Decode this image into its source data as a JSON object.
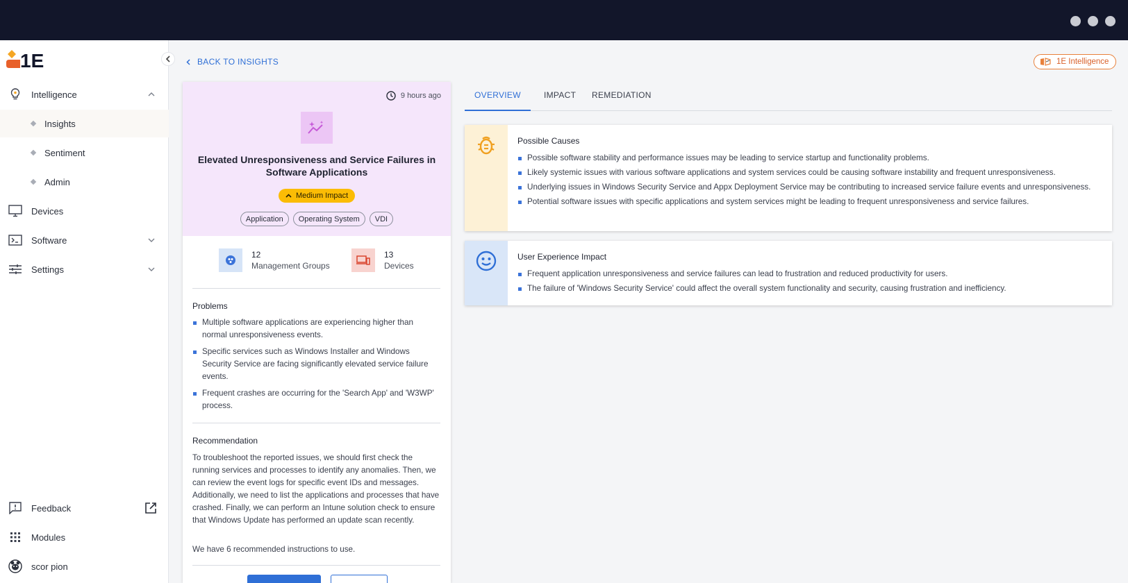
{
  "sidebar": {
    "brand_text": "1E",
    "items": [
      {
        "label": "Intelligence"
      },
      {
        "label": "Insights"
      },
      {
        "label": "Sentiment"
      },
      {
        "label": "Admin"
      },
      {
        "label": "Devices"
      },
      {
        "label": "Software"
      },
      {
        "label": "Settings"
      }
    ],
    "bottom": [
      {
        "label": "Feedback"
      },
      {
        "label": "Modules"
      },
      {
        "label": "scor pion"
      }
    ]
  },
  "header": {
    "back_label": "BACK TO INSIGHTS",
    "badge_label": "1E Intelligence"
  },
  "insight": {
    "time_ago": "9 hours ago",
    "title": "Elevated Unresponsiveness and Service Failures in Software Applications",
    "impact": "Medium Impact",
    "tags": [
      "Application",
      "Operating System",
      "VDI"
    ],
    "stats": {
      "groups_count": "12",
      "groups_label": "Management Groups",
      "devices_count": "13",
      "devices_label": "Devices"
    },
    "problems_title": "Problems",
    "problems": [
      "Multiple software applications are experiencing higher than normal unresponsiveness events.",
      "Specific services such as Windows Installer and Windows Security Service are facing significantly elevated service failure events.",
      "Frequent crashes are occurring for the 'Search App' and 'W3WP' process."
    ],
    "recommendation_title": "Recommendation",
    "recommendation_text": "To troubleshoot the reported issues, we should first check the running services and processes to identify any anomalies. Then, we can review the event logs for specific event IDs and messages. Additionally, we need to list the applications and processes that have crashed. Finally, we can perform an Intune solution check to ensure that Windows Update has performed an update scan recently.",
    "recommended_count_text": "We have 6 recommended instructions to use."
  },
  "tabs": [
    "OVERVIEW",
    "IMPACT",
    "REMEDIATION"
  ],
  "panels": {
    "causes": {
      "title": "Possible Causes",
      "items": [
        "Possible software stability and performance issues may be leading to service startup and functionality problems.",
        "Likely systemic issues with various software applications and system services could be causing software instability and frequent unresponsiveness.",
        "Underlying issues in Windows Security Service and Appx Deployment Service may be contributing to increased service failure events and unresponsiveness.",
        "Potential software issues with specific applications and system services might be leading to frequent unresponsiveness and service failures."
      ]
    },
    "ux": {
      "title": "User Experience Impact",
      "items": [
        "Frequent application unresponsiveness and service failures can lead to frustration and reduced productivity for users.",
        "The failure of 'Windows Security Service' could affect the overall system functionality and security, causing frustration and inefficiency."
      ]
    }
  },
  "colors": {
    "accent": "#2f6fd6",
    "impact_medium": "#fbbc05",
    "brand_orange": "#e8803a",
    "topbar": "#12162a"
  }
}
